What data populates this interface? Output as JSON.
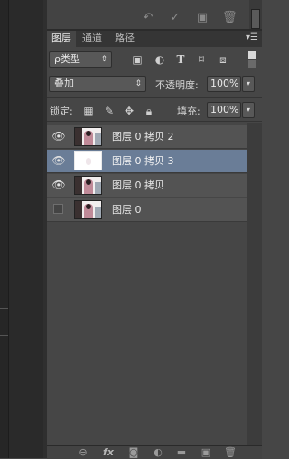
{
  "upper_toolbar": {
    "icons": [
      "undo-icon",
      "check-icon",
      "new-document-icon",
      "trash-icon"
    ]
  },
  "tabs": [
    {
      "label": "图层",
      "active": true
    },
    {
      "label": "通道",
      "active": false
    },
    {
      "label": "路径",
      "active": false
    }
  ],
  "filter": {
    "kind_label": "ρ类型",
    "icons": [
      "image-filter-icon",
      "adjustment-filter-icon",
      "text-filter-icon",
      "shape-filter-icon",
      "smartobject-filter-icon"
    ]
  },
  "blend": {
    "mode": "叠加",
    "opacity_label": "不透明度:",
    "opacity_value": "100%"
  },
  "lock": {
    "label": "锁定:",
    "fill_label": "填充:",
    "fill_value": "100%"
  },
  "layers": [
    {
      "name": "图层 0 拷贝 2",
      "visible": true,
      "selected": false,
      "thumb": "photo"
    },
    {
      "name": "图层 0 拷贝 3",
      "visible": true,
      "selected": true,
      "thumb": "white"
    },
    {
      "name": "图层 0 拷贝",
      "visible": true,
      "selected": false,
      "thumb": "photo"
    },
    {
      "name": "图层 0",
      "visible": false,
      "selected": false,
      "thumb": "photo"
    }
  ],
  "bottom_toolbar": {
    "fx_label": "fx",
    "icons": [
      "link-icon",
      "fx-icon",
      "mask-icon",
      "adjustment-icon",
      "folder-icon",
      "new-layer-icon",
      "trash-icon"
    ]
  }
}
